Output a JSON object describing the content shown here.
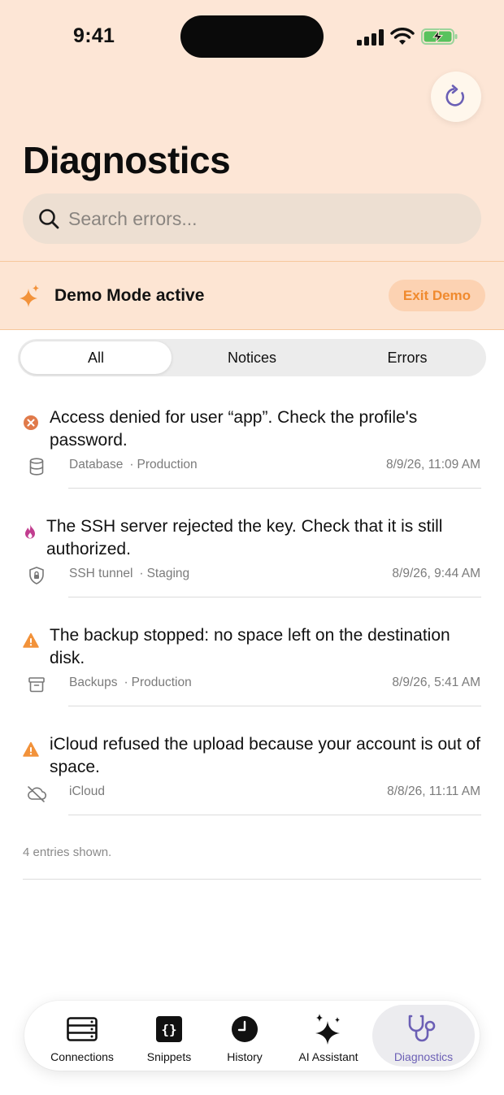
{
  "status_bar": {
    "time": "9:41"
  },
  "header": {
    "title": "Diagnostics"
  },
  "search": {
    "placeholder": "Search errors..."
  },
  "demo": {
    "label": "Demo Mode active",
    "exit_label": "Exit Demo"
  },
  "filter": {
    "segments": [
      "All",
      "Notices",
      "Errors"
    ],
    "selected": "All"
  },
  "entries": [
    {
      "level": "error",
      "message": "Access denied for user “app”. Check the profile's password.",
      "category": "Database",
      "environment": "Production",
      "timestamp": "8/9/26, 11:09 AM",
      "category_icon": "database-icon"
    },
    {
      "level": "critical",
      "message": "The SSH server rejected the key. Check that it is still authorized.",
      "category": "SSH tunnel",
      "environment": "Staging",
      "timestamp": "8/9/26, 9:44 AM",
      "category_icon": "lock-shield-icon"
    },
    {
      "level": "warning",
      "message": "The backup stopped: no space left on the destination disk.",
      "category": "Backups",
      "environment": "Production",
      "timestamp": "8/9/26, 5:41 AM",
      "category_icon": "archive-box-icon"
    },
    {
      "level": "warning",
      "message": "iCloud refused the upload because your account is out of space.",
      "category": "iCloud",
      "environment": "",
      "timestamp": "8/8/26, 11:11 AM",
      "category_icon": "cloud-off-icon"
    }
  ],
  "footer": {
    "count_text": "4 entries shown."
  },
  "tabbar": {
    "tabs": [
      {
        "label": "Connections",
        "icon": "server-icon"
      },
      {
        "label": "Snippets",
        "icon": "braces-icon"
      },
      {
        "label": "History",
        "icon": "clock-icon"
      },
      {
        "label": "AI Assistant",
        "icon": "sparkles-icon"
      },
      {
        "label": "Diagnostics",
        "icon": "stethoscope-icon"
      }
    ],
    "active": "Diagnostics"
  },
  "colors": {
    "header_bg": "#fde6d6",
    "accent_orange": "#f08a2e",
    "error_icon": "#e07a4a",
    "critical_icon": "#c13d8f",
    "warning_icon": "#f2923a",
    "active_tab": "#6b5fb5"
  }
}
